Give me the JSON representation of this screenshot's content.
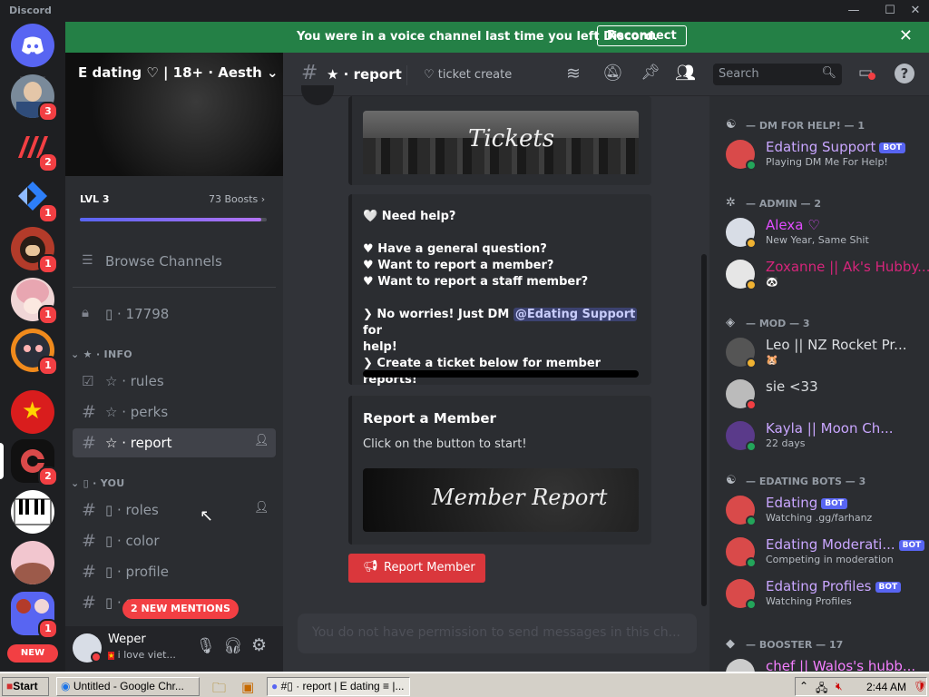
{
  "app": {
    "title": "Discord"
  },
  "notice": {
    "message": "You were in a voice channel last time you left Discord.",
    "button": "Reconnect"
  },
  "rail": {
    "badges": [
      "3",
      "2",
      "1",
      "1",
      "1",
      "1",
      "2",
      "1"
    ],
    "new_label": "NEW"
  },
  "server": {
    "name": "E dating ♡ | 18+ · Aesth",
    "level": "LVL 3",
    "boosts": "73 Boosts",
    "boost_progress": 0.97
  },
  "channels": {
    "browse": "Browse Channels",
    "locked": "▯ · 17798",
    "cat_info": "★ · INFO",
    "cat_you": "▯ · YOU",
    "items": [
      {
        "label": "☆ · rules"
      },
      {
        "label": "☆ · perks"
      },
      {
        "label": "☆ · report"
      },
      {
        "label": "▯ · roles"
      },
      {
        "label": "▯ · color"
      },
      {
        "label": "▯ · profile"
      },
      {
        "label": "▯ · se"
      }
    ],
    "mentions": "2 NEW MENTIONS"
  },
  "user": {
    "name": "Weper",
    "status": "i love viet..."
  },
  "header": {
    "channel": "★ · report",
    "topic": "♡ ticket create",
    "search_placeholder": "Search"
  },
  "messages": {
    "tickets_img": "Tickets",
    "need_help": "Need help?",
    "q1": "Have a general question?",
    "q2": "Want to report a member?",
    "q3": "Want to report a staff member?",
    "worries": "No worries! Just DM",
    "mention": "@Edating Support",
    "for_help": "for",
    "help2": "help!",
    "create": "Create a ticket below for member reports!",
    "report_title": "Report a Member",
    "report_desc": "Click on the button to start!",
    "report_img": "Member Report",
    "report_button": "Report Member",
    "composer": "You do not have permission to send messages in this ch..."
  },
  "members": {
    "groups": [
      {
        "title": "— DM FOR HELP! — 1",
        "members": [
          {
            "name": "Edating Support",
            "bot": "BOT",
            "status": "Playing DM Me For Help!",
            "color": "#c9a6ff"
          }
        ]
      },
      {
        "title": "— ADMIN — 2",
        "members": [
          {
            "name": "Alexa ♡",
            "status": "New Year, Same Shit",
            "color": "#e14cff"
          },
          {
            "name": "Zoxanne || Ak's Hubby...",
            "status": "🐼",
            "color": "#d6257b"
          }
        ]
      },
      {
        "title": "— MOD — 3",
        "members": [
          {
            "name": "Leo || NZ Rocket Pr...",
            "status": "🐹",
            "color": "#dbdee1"
          },
          {
            "name": "sie <33",
            "status": "",
            "color": "#dbdee1"
          },
          {
            "name": "Kayla || Moon Ch...",
            "status": "22 days",
            "color": "#c9a6ff"
          }
        ]
      },
      {
        "title": "— EDATING BOTS — 3",
        "members": [
          {
            "name": "Edating",
            "bot": "BOT",
            "status": "Watching .gg/farhanz",
            "color": "#c9a6ff"
          },
          {
            "name": "Edating Moderati...",
            "bot": "BOT",
            "status": "Competing in moderation",
            "color": "#c9a6ff"
          },
          {
            "name": "Edating Profiles",
            "bot": "BOT",
            "status": "Watching Profiles",
            "color": "#c9a6ff"
          }
        ]
      },
      {
        "title": "— BOOSTER — 17",
        "members": [
          {
            "name": "chef || Walos's hubb...",
            "status": "",
            "color": "#f47fff"
          }
        ]
      }
    ]
  },
  "taskbar": {
    "start": "Start",
    "task1": "Untitled - Google Chr...",
    "task2": "#▯ · report | E dating ≡ |...",
    "clock": "2:44 AM"
  }
}
